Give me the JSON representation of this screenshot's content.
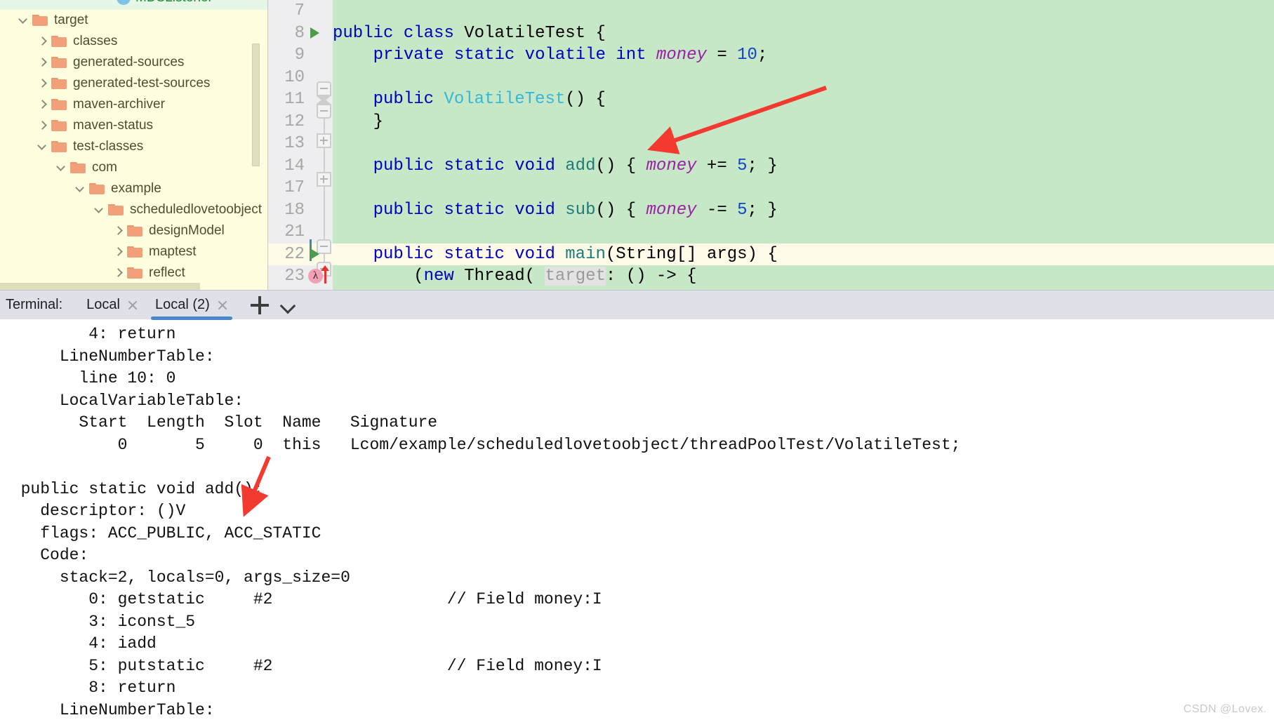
{
  "project_tree": {
    "header_label": "MDSListener",
    "items": [
      {
        "label": "target",
        "depth": 0,
        "state": "expanded"
      },
      {
        "label": "classes",
        "depth": 1,
        "state": "collapsed"
      },
      {
        "label": "generated-sources",
        "depth": 1,
        "state": "collapsed"
      },
      {
        "label": "generated-test-sources",
        "depth": 1,
        "state": "collapsed"
      },
      {
        "label": "maven-archiver",
        "depth": 1,
        "state": "collapsed"
      },
      {
        "label": "maven-status",
        "depth": 1,
        "state": "collapsed"
      },
      {
        "label": "test-classes",
        "depth": 1,
        "state": "expanded"
      },
      {
        "label": "com",
        "depth": 2,
        "state": "expanded"
      },
      {
        "label": "example",
        "depth": 3,
        "state": "expanded"
      },
      {
        "label": "scheduledlovetoobject",
        "depth": 4,
        "state": "expanded"
      },
      {
        "label": "designModel",
        "depth": 5,
        "state": "collapsed"
      },
      {
        "label": "maptest",
        "depth": 5,
        "state": "collapsed"
      },
      {
        "label": "reflect",
        "depth": 5,
        "state": "collapsed"
      }
    ]
  },
  "editor": {
    "lines": [
      {
        "num": "7",
        "text": ""
      },
      {
        "num": "8",
        "text": "public class VolatileTest {"
      },
      {
        "num": "9",
        "text": "    private static volatile int money = 10;"
      },
      {
        "num": "10",
        "text": ""
      },
      {
        "num": "11",
        "text": "    public VolatileTest() {"
      },
      {
        "num": "12",
        "text": "    }"
      },
      {
        "num": "13",
        "text": ""
      },
      {
        "num": "14",
        "text": "    public static void add() { money += 5; }"
      },
      {
        "num": "17",
        "text": ""
      },
      {
        "num": "18",
        "text": "    public static void sub() { money -= 5; }"
      },
      {
        "num": "21",
        "text": ""
      },
      {
        "num": "22",
        "text": "    public static void main(String[] args) {"
      },
      {
        "num": "23",
        "text": "        (new Thread( target: () -> {"
      }
    ],
    "parameter_hint": "target:",
    "gutter_icons": {
      "run_line_8": "run-arrow-icon",
      "run_line_22": "run-arrow-icon",
      "lambda_line_23": "lambda-badge-icon",
      "up_arrow_line_23": "up-arrow-icon"
    }
  },
  "terminal": {
    "label": "Terminal:",
    "tabs": [
      {
        "label": "Local",
        "active": false
      },
      {
        "label": "Local (2)",
        "active": true
      }
    ],
    "add_tab": "plus-icon",
    "more_tabs": "chevron-down-icon",
    "output": [
      "         4: return",
      "      LineNumberTable:",
      "        line 10: 0",
      "      LocalVariableTable:",
      "        Start  Length  Slot  Name   Signature",
      "            0       5     0  this   Lcom/example/scheduledlovetoobject/threadPoolTest/VolatileTest;",
      "",
      "  public static void add();",
      "    descriptor: ()V",
      "    flags: ACC_PUBLIC, ACC_STATIC",
      "    Code:",
      "      stack=2, locals=0, args_size=0",
      "         0: getstatic     #2                  // Field money:I",
      "         3: iconst_5",
      "         4: iadd",
      "         5: putstatic     #2                  // Field money:I",
      "         8: return",
      "      LineNumberTable:"
    ]
  },
  "annotations": {
    "arrow_editor": "red-arrow-annotation",
    "arrow_terminal": "red-arrow-annotation",
    "arrow_color": "#f23a30"
  },
  "watermark": "CSDN @Lovex."
}
